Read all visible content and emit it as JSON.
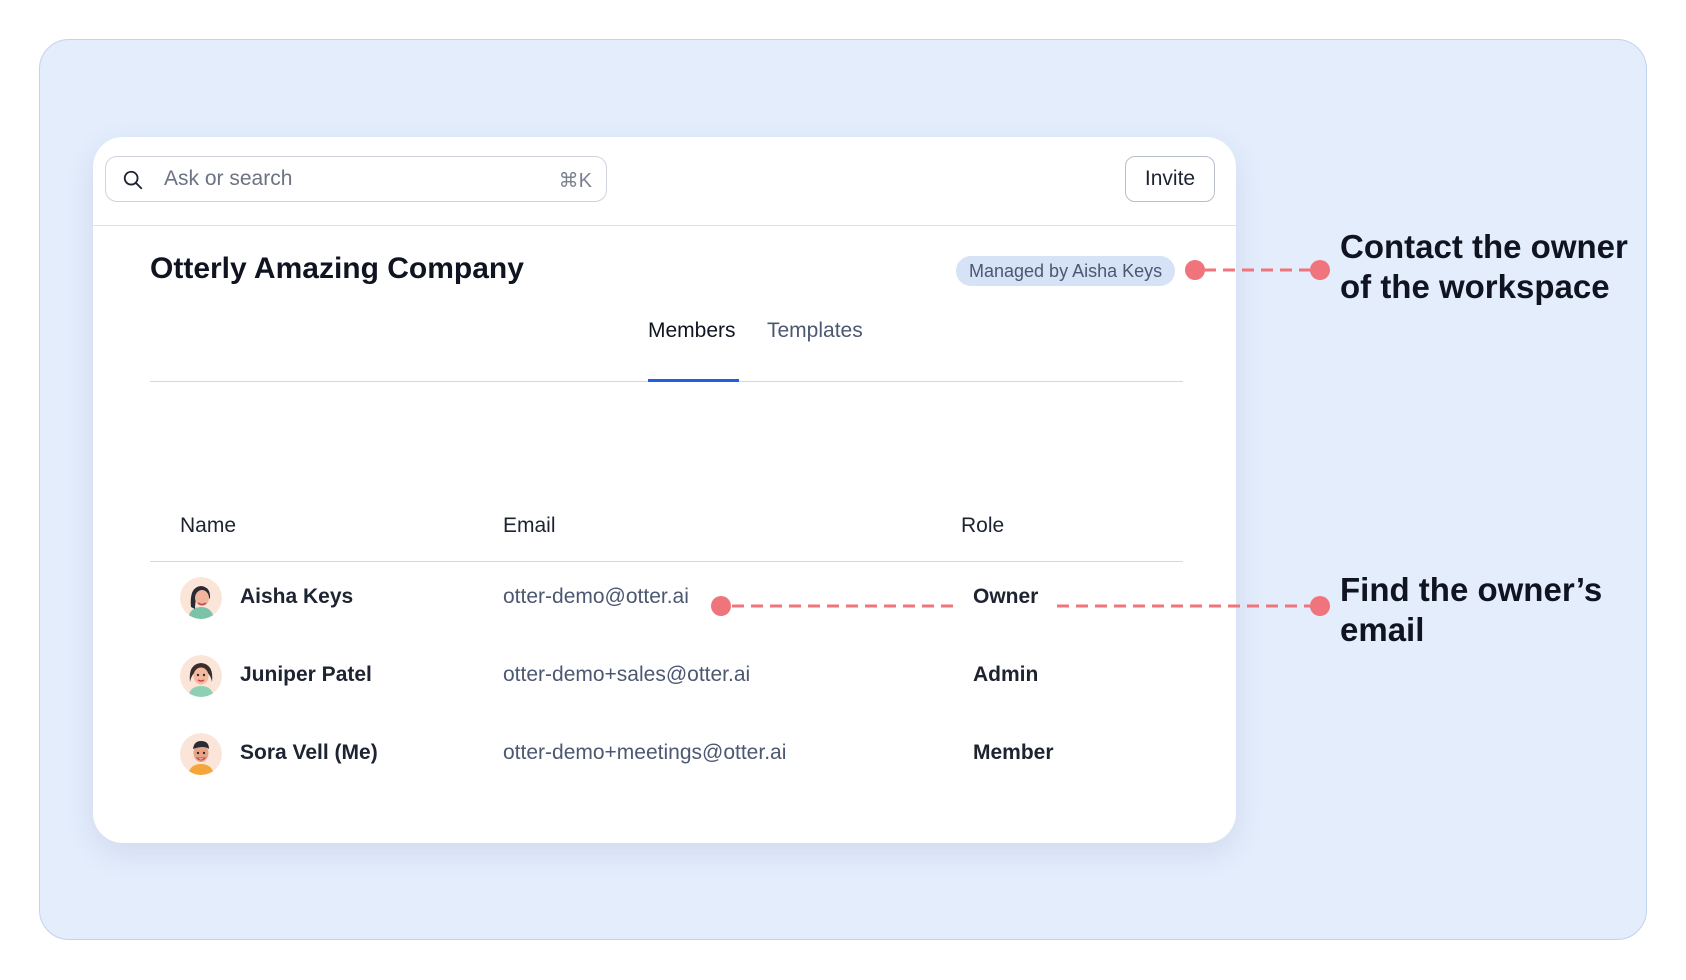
{
  "search": {
    "placeholder": "Ask or search",
    "shortcut": "⌘K",
    "icon": "search-icon"
  },
  "header": {
    "invite_label": "Invite"
  },
  "workspace": {
    "name": "Otterly Amazing Company",
    "badge": "Managed by Aisha Keys"
  },
  "tabs": [
    {
      "label": "Members",
      "active": true
    },
    {
      "label": "Templates",
      "active": false
    }
  ],
  "table": {
    "columns": [
      "Name",
      "Email",
      "Role"
    ],
    "rows": [
      {
        "name": "Aisha Keys",
        "email": "otter-demo@otter.ai",
        "role": "Owner",
        "avatar": "avatar-aisha"
      },
      {
        "name": "Juniper Patel",
        "email": "otter-demo+sales@otter.ai",
        "role": "Admin",
        "avatar": "avatar-juniper"
      },
      {
        "name": "Sora Vell (Me)",
        "email": "otter-demo+meetings@otter.ai",
        "role": "Member",
        "avatar": "avatar-sora"
      }
    ]
  },
  "annotations": [
    {
      "text_line1": "Contact the owner",
      "text_line2": "of the workspace"
    },
    {
      "text_line1": "Find the owner’s",
      "text_line2": "email"
    }
  ],
  "colors": {
    "background": "#e3edfc",
    "accent": "#1f5fe6",
    "annotation": "#f0747b",
    "badge_bg": "#d6e2f6"
  }
}
